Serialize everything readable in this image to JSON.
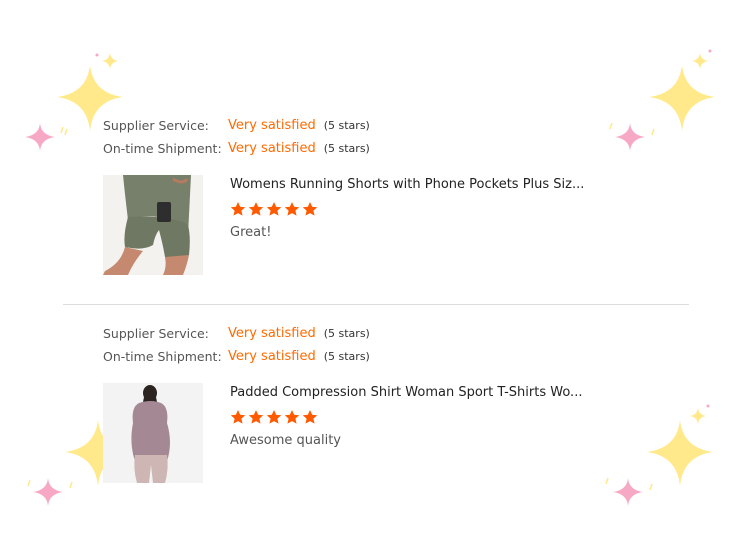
{
  "reviews": [
    {
      "supplier_label": "Supplier Service:",
      "supplier_value": "Very satisfied",
      "supplier_stars": "(5 stars)",
      "shipment_label": "On-time Shipment:",
      "shipment_value": "Very satisfied",
      "shipment_stars": "(5 stars)",
      "product_title": "Womens Running Shorts with Phone Pockets Plus Siz...",
      "rating": 5,
      "comment": "Great!"
    },
    {
      "supplier_label": "Supplier Service:",
      "supplier_value": "Very satisfied",
      "supplier_stars": "(5 stars)",
      "shipment_label": "On-time Shipment:",
      "shipment_value": "Very satisfied",
      "shipment_stars": "(5 stars)",
      "product_title": "Padded Compression Shirt Woman Sport T-Shirts Wo...",
      "rating": 5,
      "comment": "Awesome quality"
    }
  ],
  "colors": {
    "accent": "#ff6a00",
    "star": "#ff5a00",
    "sparkle_yellow": "#ffe98a",
    "sparkle_pink": "#f7a8c4"
  },
  "icons": [
    "star-icon",
    "sparkle-icon",
    "product-thumbnail"
  ]
}
